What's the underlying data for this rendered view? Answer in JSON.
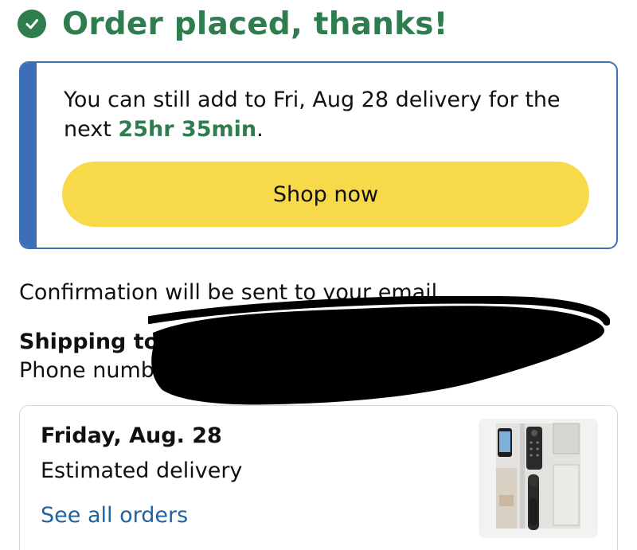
{
  "header": {
    "title": "Order placed, thanks!",
    "icon": "check-circle-icon"
  },
  "delivery_card": {
    "text_prefix": "You can still add to Fri, Aug 28 delivery for the next ",
    "countdown": "25hr 35min",
    "text_suffix": ".",
    "button_label": "Shop now"
  },
  "confirmation_text": "Confirmation will be sent to your email.",
  "shipping": {
    "label": "Shipping to",
    "phone_label": "Phone number"
  },
  "order": {
    "date": "Friday, Aug. 28",
    "status": "Estimated delivery",
    "link_label": "See all orders",
    "product_image": "smart-lock-product-image"
  },
  "colors": {
    "success": "#2f7d4f",
    "accent_blue": "#3d6fb8",
    "button_yellow": "#f8d94a",
    "link": "#2162a1"
  }
}
